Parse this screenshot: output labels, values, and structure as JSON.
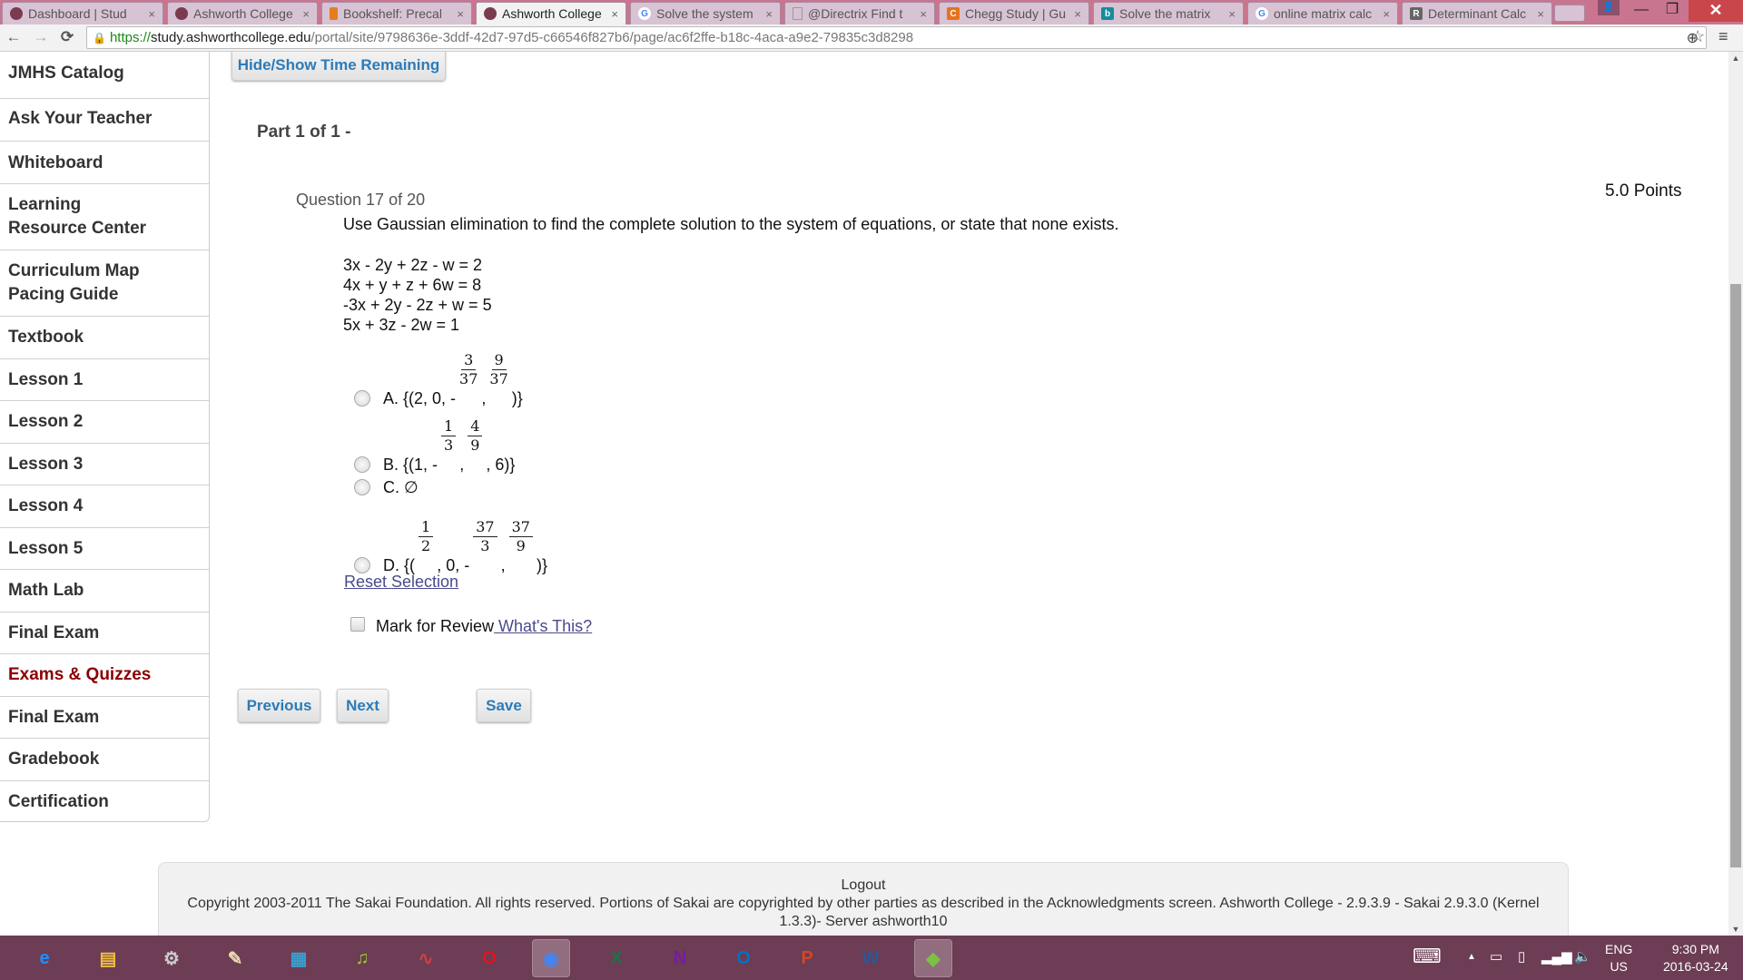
{
  "browser": {
    "tabs": [
      {
        "title": "Dashboard | Stud",
        "icon": "ashworth-icon",
        "color": "#7b3b4f"
      },
      {
        "title": "Ashworth College",
        "icon": "ashworth-icon",
        "color": "#7b3b4f"
      },
      {
        "title": "Bookshelf: Precal",
        "icon": "bookshelf-icon",
        "color": "#e57c1f"
      },
      {
        "title": "Ashworth College",
        "icon": "ashworth-icon",
        "color": "#7b3b4f",
        "active": true
      },
      {
        "title": "Solve the system",
        "icon": "google-icon",
        "color": "#4285f4"
      },
      {
        "title": "@Directrix Find t",
        "icon": "page-icon",
        "color": "#999999"
      },
      {
        "title": "Chegg Study | Gu",
        "icon": "chegg-icon",
        "color": "#e8711a"
      },
      {
        "title": "Solve the matrix",
        "icon": "bing-icon",
        "color": "#148d9e"
      },
      {
        "title": "online matrix calc",
        "icon": "google-icon",
        "color": "#4285f4"
      },
      {
        "title": "Determinant Calc",
        "icon": "r-icon",
        "color": "#666666"
      }
    ],
    "url": {
      "scheme": "https://",
      "host": "study.ashworthcollege.edu",
      "path": "/portal/site/9798636e-3ddf-42d7-97d5-c66546f827b6/page/ac6f2ffe-b18c-4aca-a9e2-79835c3d8298"
    },
    "glyphs": {
      "back": "←",
      "forward": "→",
      "reload": "⟳",
      "lock": "🔒",
      "zoom": "⊕",
      "star": "☆",
      "menu": "≡",
      "close_tab": "×",
      "minimize": "—",
      "maximize": "❐",
      "close": "✕",
      "profile": "👤"
    }
  },
  "sidebar": {
    "items": [
      {
        "label": "JMHS Catalog"
      },
      {
        "label": "Ask Your Teacher"
      },
      {
        "label": "Whiteboard"
      },
      {
        "label": "Learning Resource Center"
      },
      {
        "label": "Curriculum Map Pacing Guide"
      },
      {
        "label": "Textbook"
      },
      {
        "label": "Lesson 1"
      },
      {
        "label": "Lesson 2"
      },
      {
        "label": "Lesson 3"
      },
      {
        "label": "Lesson 4"
      },
      {
        "label": "Lesson 5"
      },
      {
        "label": "Math Lab"
      },
      {
        "label": "Final Exam"
      },
      {
        "label": "Exams & Quizzes",
        "active": true
      },
      {
        "label": "Final Exam"
      },
      {
        "label": "Gradebook"
      },
      {
        "label": "Certification"
      }
    ],
    "active_color": "#8b0000"
  },
  "quiz": {
    "hide_show_label": "Hide/Show Time Remaining",
    "part_title": "Part 1 of 1 -",
    "question_number": "Question 17 of 20",
    "points": "5.0 Points",
    "prompt": "Use Gaussian elimination to find the complete solution to the system of equations, or state that none exists.",
    "equations": [
      "3x - 2y + 2z - w = 2",
      "4x + y + z + 6w = 8",
      "-3x + 2y - 2z + w = 5",
      "5x + 3z - 2w = 1"
    ],
    "options": {
      "a": {
        "prefix": "A. {(2, 0, -",
        "f1": {
          "num": "3",
          "den": "37"
        },
        "mid": ",",
        "f2": {
          "num": "9",
          "den": "37"
        },
        "suffix": ")}"
      },
      "b": {
        "prefix": "B. {(1, -",
        "f1": {
          "num": "1",
          "den": "3"
        },
        "mid": ",",
        "f2": {
          "num": "4",
          "den": "9"
        },
        "suffix": ", 6)}"
      },
      "c": {
        "label": "C. ∅"
      },
      "d": {
        "prefix": "D. {(",
        "f1": {
          "num": "1",
          "den": "2"
        },
        "mid1": ", 0, -",
        "f2": {
          "num": "37",
          "den": "3"
        },
        "mid2": ",",
        "f3": {
          "num": "37",
          "den": "9"
        },
        "suffix": ")}"
      }
    },
    "reset_label": "Reset Selection",
    "review_label": "Mark for Review",
    "whats_this_label": " What's This?",
    "buttons": {
      "previous": "Previous",
      "next": "Next",
      "save": "Save"
    },
    "link_color": "#4a4a8c",
    "button_text_color": "#2b7bb9"
  },
  "footer": {
    "logout": "Logout",
    "copyright": "Copyright 2003-2011 The Sakai Foundation. All rights reserved. Portions of Sakai are copyrighted by other parties as described in the Acknowledgments screen. Ashworth College - 2.9.3.9 - Sakai 2.9.3.0 (Kernel 1.3.3)- Server ashworth10"
  },
  "taskbar": {
    "apps": [
      {
        "name": "internet-explorer",
        "glyph": "e",
        "color": "#1e90ff"
      },
      {
        "name": "file-explorer",
        "glyph": "▤",
        "color": "#f0c040"
      },
      {
        "name": "system-settings",
        "glyph": "⚙",
        "color": "#cccccc"
      },
      {
        "name": "paint-easel",
        "glyph": "✎",
        "color": "#e8d8b0"
      },
      {
        "name": "video-player",
        "glyph": "▦",
        "color": "#3aa0d0"
      },
      {
        "name": "music-player",
        "glyph": "♫",
        "color": "#9acd32"
      },
      {
        "name": "audio-editor",
        "glyph": "∿",
        "color": "#d04040"
      },
      {
        "name": "opera",
        "glyph": "O",
        "color": "#e0141e"
      },
      {
        "name": "chrome",
        "glyph": "◉",
        "color": "#4285f4",
        "active": true
      },
      {
        "name": "excel",
        "glyph": "X",
        "color": "#1e7145"
      },
      {
        "name": "onenote",
        "glyph": "N",
        "color": "#7719aa"
      },
      {
        "name": "outlook",
        "glyph": "O",
        "color": "#0072c6"
      },
      {
        "name": "powerpoint",
        "glyph": "P",
        "color": "#d24726"
      },
      {
        "name": "word",
        "glyph": "W",
        "color": "#2b579a"
      },
      {
        "name": "bluestacks",
        "glyph": "◆",
        "color": "#7cc242",
        "active": true
      }
    ],
    "tray": {
      "keyboard": "⌨",
      "chevron": "▲",
      "lang_top": "ENG",
      "lang_bottom": "US",
      "time": "9:30 PM",
      "date": "2016-03-24"
    }
  }
}
